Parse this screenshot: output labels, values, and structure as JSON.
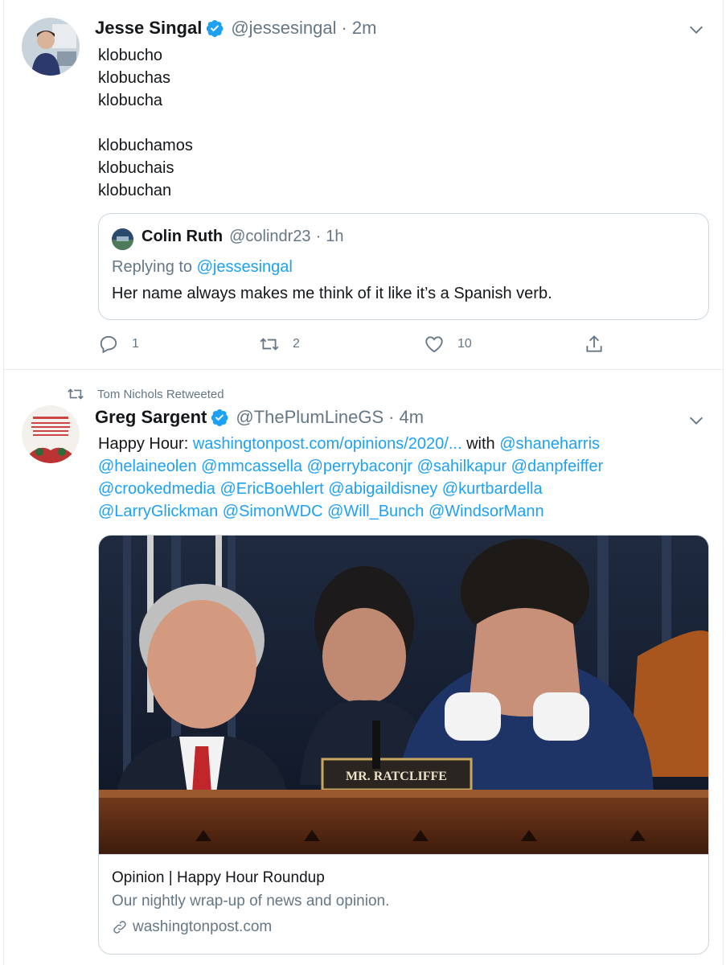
{
  "tweet1": {
    "name": "Jesse Singal",
    "handle": "@jessesingal",
    "time": "2m",
    "lines": [
      "klobucho",
      "klobuchas",
      "klobucha",
      "",
      "klobuchamos",
      "klobuchais",
      "klobuchan"
    ],
    "quote": {
      "name": "Colin Ruth",
      "handle": "@colindr23",
      "time": "1h",
      "replying_prefix": "Replying to ",
      "replying_to": "@jessesingal",
      "text": "Her name always makes me think of it like it’s a Spanish verb."
    },
    "actions": {
      "replies": "1",
      "retweets": "2",
      "likes": "10"
    }
  },
  "retweet_label": "Tom Nichols Retweeted",
  "tweet2": {
    "name": "Greg Sargent",
    "handle": "@ThePlumLineGS",
    "time": "4m",
    "text": {
      "prefix": "Happy Hour: ",
      "url": "washingtonpost.com/opinions/2020/...",
      "with": " with ",
      "mention1": "@shaneharris",
      "line2": "@helaineolen @mmcassella @perrybaconjr @sahilkapur @danpfeiffer",
      "line3": "@crookedmedia @EricBoehlert @abigaildisney @kurtbardella",
      "line4": "@LarryGlickman @SimonWDC @Will_Bunch @WindsorMann"
    },
    "card": {
      "nameplate": "MR. RATCLIFFE",
      "title": "Opinion | Happy Hour Roundup",
      "description": "Our nightly wrap-up of news and opinion.",
      "domain": "washingtonpost.com"
    }
  },
  "colors": {
    "link": "#1da1f2",
    "secondary_text": "#657786",
    "border": "#e6ecf0",
    "verified": "#1da1f2"
  },
  "icons": [
    "verified-badge-icon",
    "caret-down-icon",
    "reply-icon",
    "retweet-icon",
    "like-icon",
    "share-icon",
    "link-icon"
  ]
}
